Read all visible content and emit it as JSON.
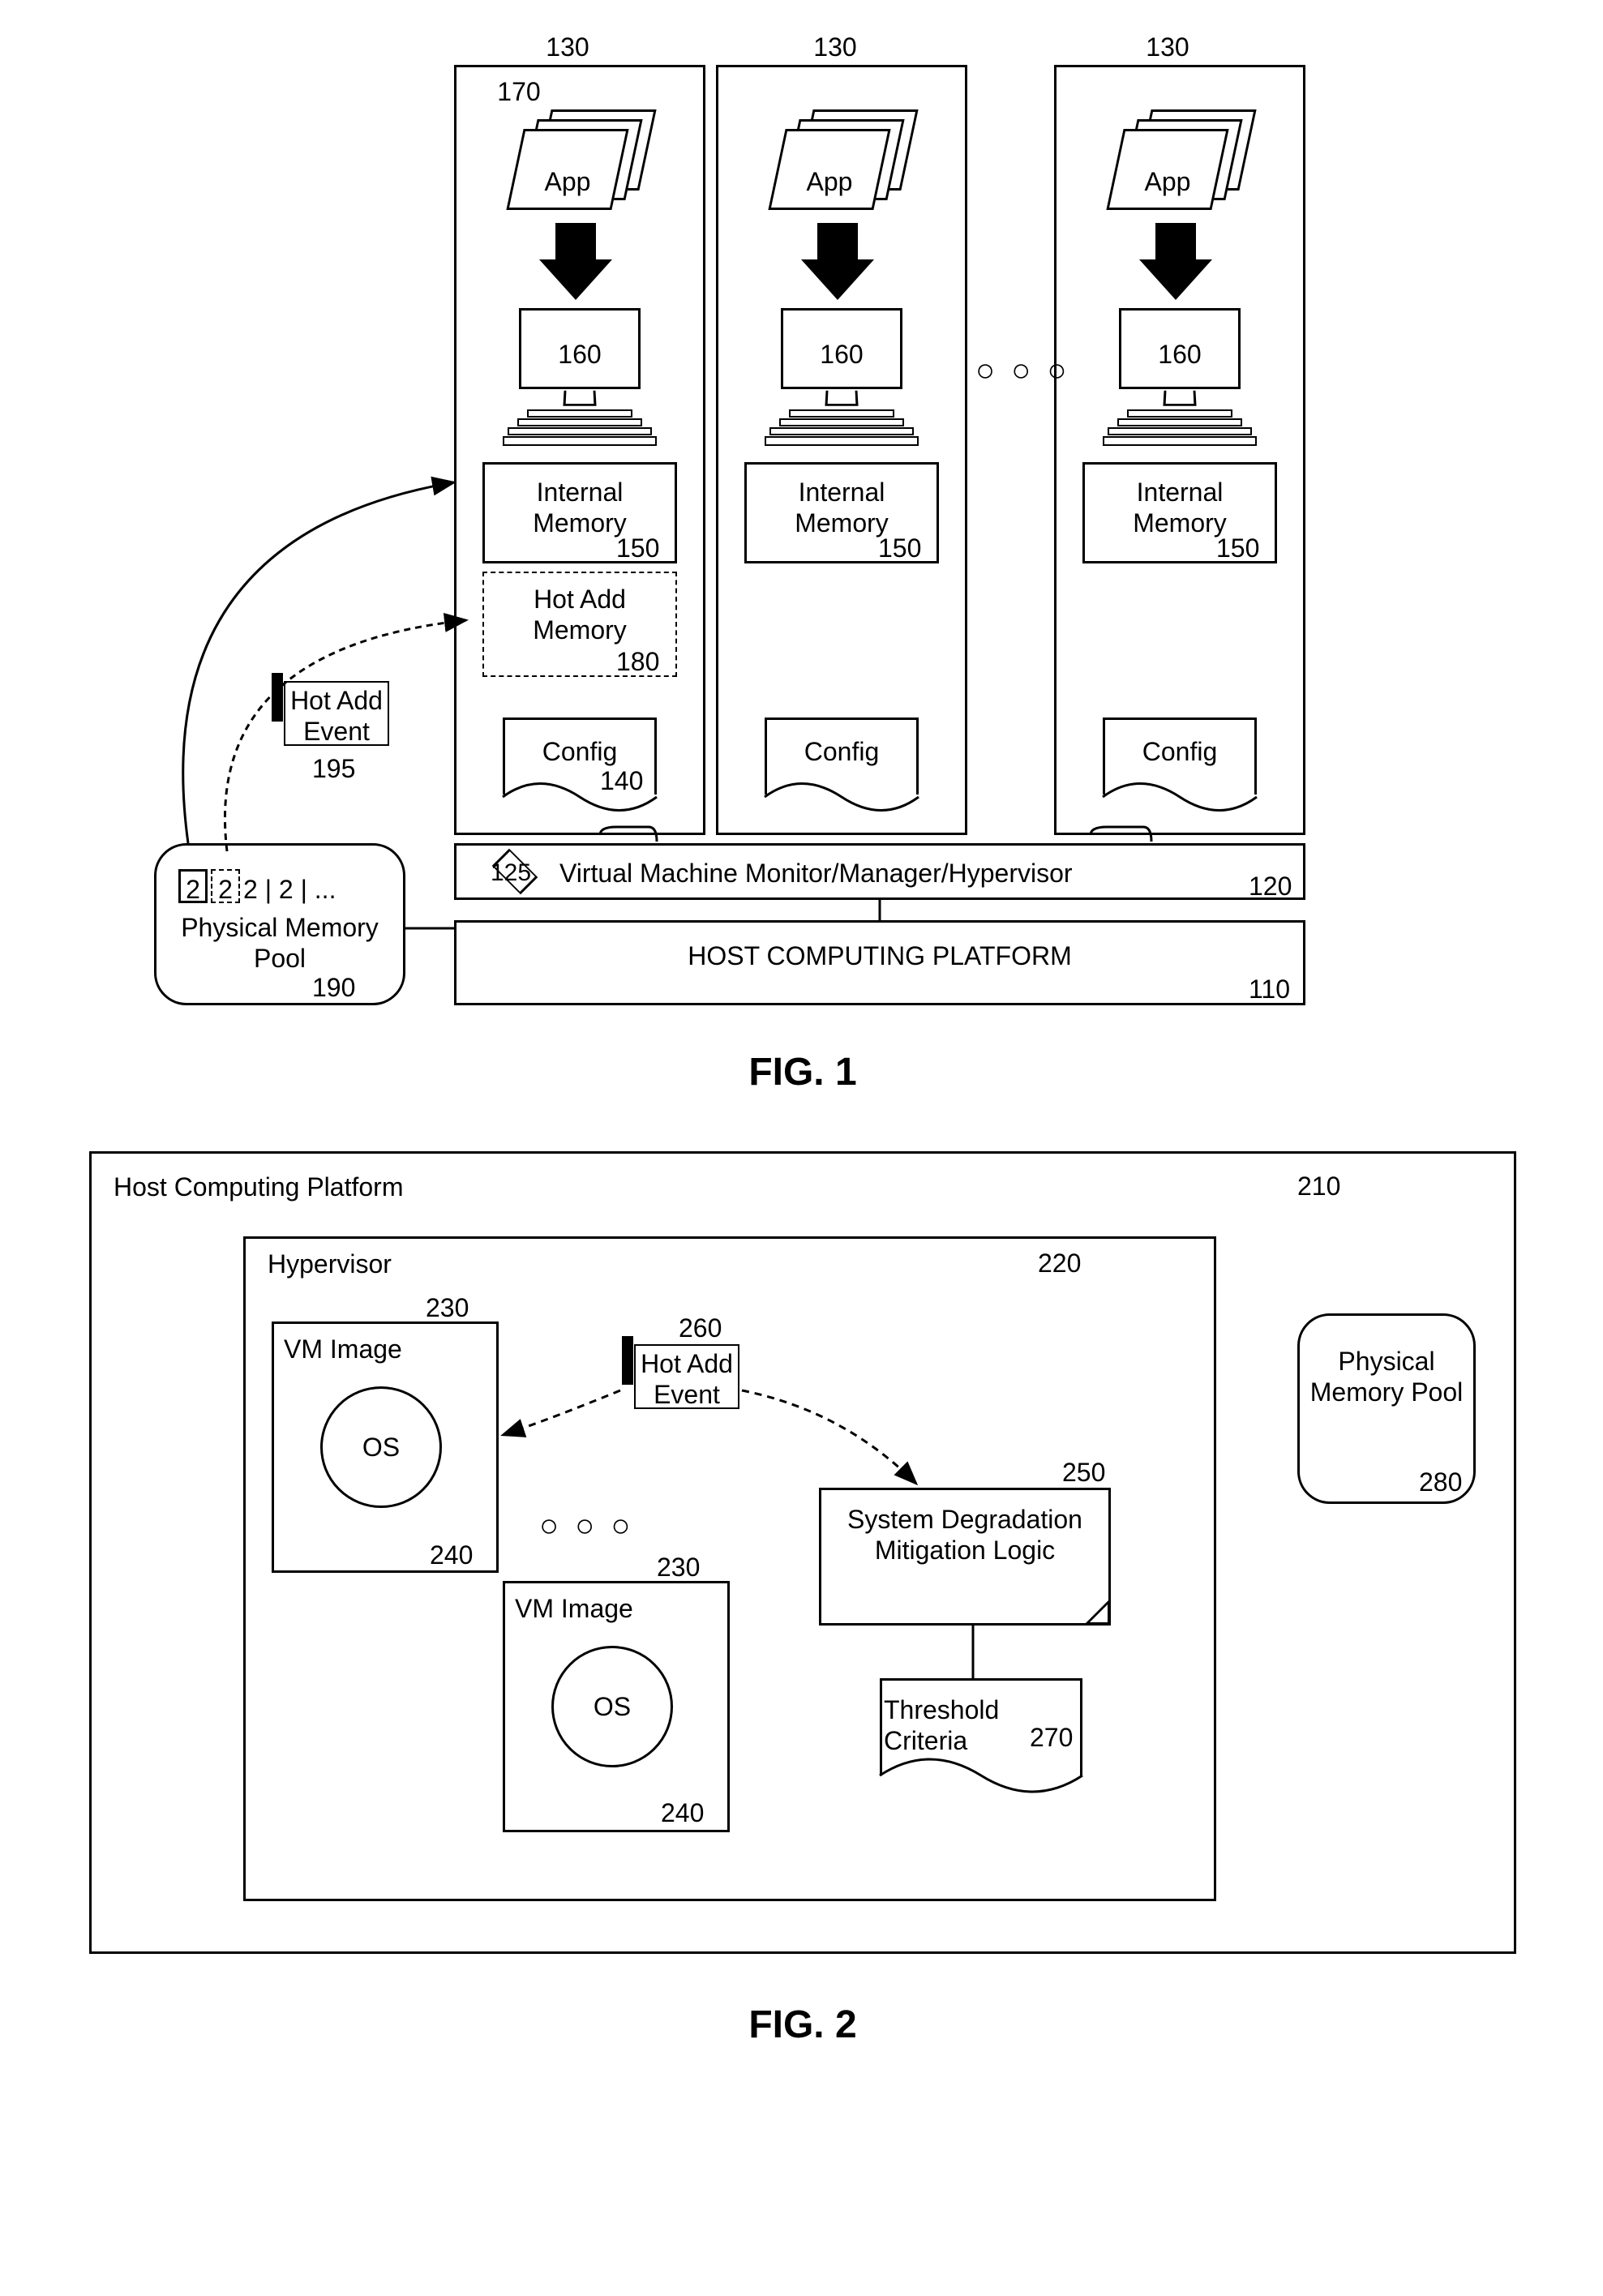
{
  "fig1": {
    "caption": "FIG. 1",
    "vm_ref": "130",
    "app_ref": "170",
    "app_label": "App",
    "computer_ref": "160",
    "internal_mem_label": "Internal Memory",
    "internal_mem_ref": "150",
    "hot_add_mem_label": "Hot Add Memory",
    "hot_add_mem_ref": "180",
    "config_label": "Config",
    "config_ref": "140",
    "hot_add_event_label": "Hot Add Event",
    "hot_add_event_ref": "195",
    "hypervisor_label": "Virtual Machine Monitor/Manager/Hypervisor",
    "hypervisor_inner_ref": "125",
    "hypervisor_ref": "120",
    "host_label": "HOST COMPUTING PLATFORM",
    "host_ref": "110",
    "pool_blocks": "2 | 2 | ...",
    "pool_label": "Physical Memory Pool",
    "pool_ref": "190"
  },
  "fig2": {
    "caption": "FIG. 2",
    "host_label": "Host Computing Platform",
    "host_ref": "210",
    "hypervisor_label": "Hypervisor",
    "hypervisor_ref": "220",
    "vm_label": "VM Image",
    "vm_ref": "230",
    "os_label": "OS",
    "os_ref": "240",
    "hot_add_event_label": "Hot Add Event",
    "hot_add_event_ref": "260",
    "logic_label": "System Degradation Mitigation Logic",
    "logic_ref": "250",
    "threshold_label": "Threshold Criteria",
    "threshold_ref": "270",
    "pool_label": "Physical Memory Pool",
    "pool_ref": "280"
  }
}
